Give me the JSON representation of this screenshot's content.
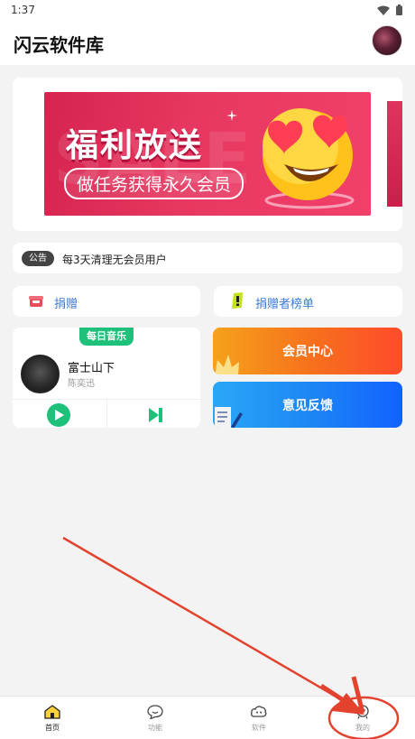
{
  "status": {
    "time": "1:37"
  },
  "appbar": {
    "title": "闪云软件库"
  },
  "banner": {
    "title": "福利放送",
    "subtitle": "做任务获得永久会员",
    "watermark": "SALE"
  },
  "notice": {
    "tag": "公告",
    "text": "每3天清理无会员用户"
  },
  "actions": {
    "donate": "捐赠",
    "donor_list": "捐赠者榜单"
  },
  "music": {
    "tag": "每日音乐",
    "song": "富士山下",
    "artist": "陈奕迅"
  },
  "cards": {
    "vip": "会员中心",
    "feedback": "意见反馈"
  },
  "nav": {
    "items": [
      {
        "label": "首页",
        "icon": "home-icon"
      },
      {
        "label": "功能",
        "icon": "chat-icon"
      },
      {
        "label": "软件",
        "icon": "cloud-chat-icon"
      },
      {
        "label": "我的",
        "icon": "profile-icon"
      }
    ]
  },
  "colors": {
    "accent_green": "#1fc17a",
    "vip_orange": "#f76e1d",
    "feedback_blue": "#1c84f4",
    "annotation_red": "#e3432e"
  }
}
